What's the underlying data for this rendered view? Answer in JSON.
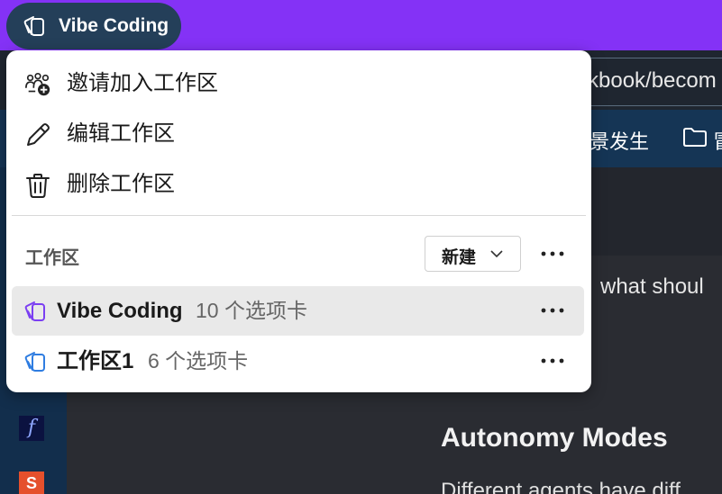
{
  "colors": {
    "accent": "#8432f6",
    "pill": "#243f59",
    "workspace_icon_purple": "#7b3ff2",
    "workspace_icon_blue": "#2f7de1"
  },
  "top_bar": {
    "workspace_name": "Vibe Coding",
    "workspace_icon": "tabs-stack-icon"
  },
  "background": {
    "address_text": "kbook/becom",
    "bookmark_text": "景发生",
    "bookmark_folder_label": "冒",
    "content_line": "what shoul",
    "content_heading": "Autonomy Modes",
    "content_paragraph": "Different agents have diff"
  },
  "menu": {
    "actions": [
      {
        "label": "邀请加入工作区",
        "icon": "invite-people-icon"
      },
      {
        "label": "编辑工作区",
        "icon": "pencil-icon"
      },
      {
        "label": "删除工作区",
        "icon": "trash-icon"
      }
    ],
    "section_title": "工作区",
    "new_label": "新建",
    "workspaces": [
      {
        "name": "Vibe Coding",
        "count": "10 个选项卡",
        "active": true
      },
      {
        "name": "工作区1",
        "count": "6 个选项卡",
        "active": false
      }
    ]
  }
}
